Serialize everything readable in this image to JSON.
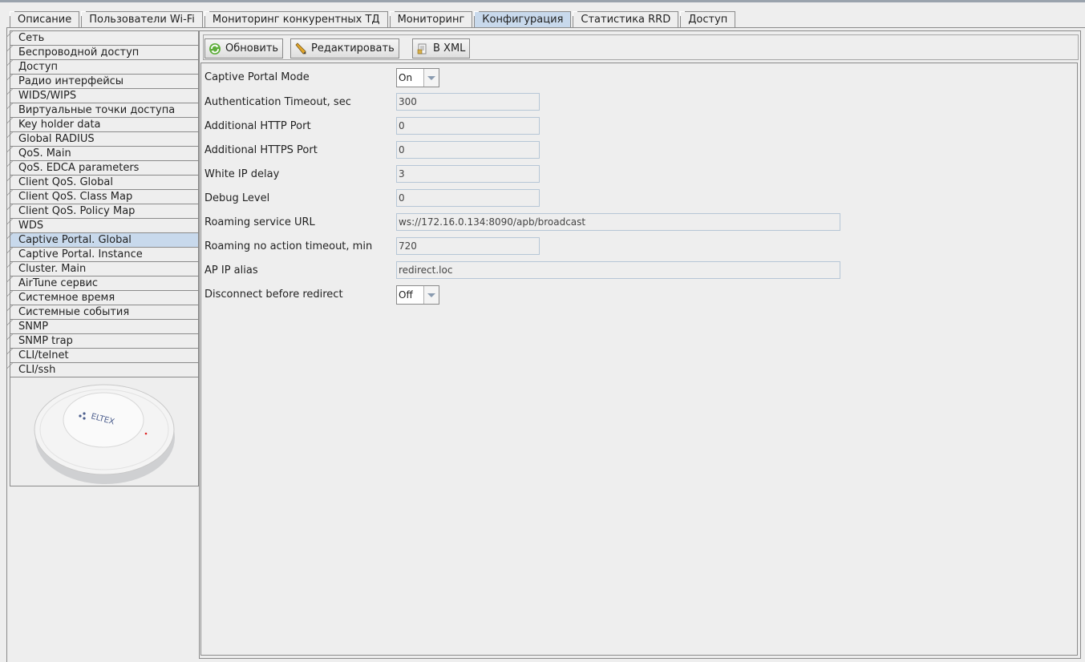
{
  "tabs": [
    "Описание",
    "Пользователи Wi-Fi",
    "Мониторинг конкурентных ТД",
    "Мониторинг",
    "Конфигурация",
    "Статистика RRD",
    "Доступ"
  ],
  "active_tab": "Конфигурация",
  "sidebar": {
    "items": [
      "Сеть",
      "Беспроводной доступ",
      "Доступ",
      "Радио интерфейсы",
      "WIDS/WIPS",
      "Виртуальные точки доступа",
      "Key holder data",
      "Global RADIUS",
      "QoS. Main",
      "QoS. EDCA parameters",
      "Client QoS. Global",
      "Client QoS. Class Map",
      "Client QoS. Policy Map",
      "WDS",
      "Captive Portal. Global",
      "Captive Portal. Instance",
      "Cluster. Main",
      "AirTune сервис",
      "Системное время",
      "Системные события",
      "SNMP",
      "SNMP trap",
      "CLI/telnet",
      "CLI/ssh"
    ],
    "active_item": "Captive Portal. Global",
    "device_logo": "ELTEX"
  },
  "toolbar": {
    "refresh_label": "Обновить",
    "edit_label": "Редактировать",
    "xml_label": "В XML"
  },
  "form": {
    "captive_portal_mode": {
      "label": "Captive Portal Mode",
      "value": "On"
    },
    "auth_timeout": {
      "label": "Authentication Timeout, sec",
      "value": "300"
    },
    "http_port": {
      "label": "Additional HTTP Port",
      "value": "0"
    },
    "https_port": {
      "label": "Additional HTTPS Port",
      "value": "0"
    },
    "white_ip_delay": {
      "label": "White IP delay",
      "value": "3"
    },
    "debug_level": {
      "label": "Debug Level",
      "value": "0"
    },
    "roaming_url": {
      "label": "Roaming service URL",
      "value": "ws://172.16.0.134:8090/apb/broadcast"
    },
    "roaming_timeout": {
      "label": "Roaming no action timeout, min",
      "value": "720"
    },
    "ap_ip_alias": {
      "label": "AP IP alias",
      "value": "redirect.loc"
    },
    "disconnect_before_redirect": {
      "label": "Disconnect before redirect",
      "value": "Off"
    }
  },
  "colors": {
    "active_bg": "#c8d9ec",
    "border": "#8a8a8a",
    "field_border": "#b6c6d6"
  }
}
